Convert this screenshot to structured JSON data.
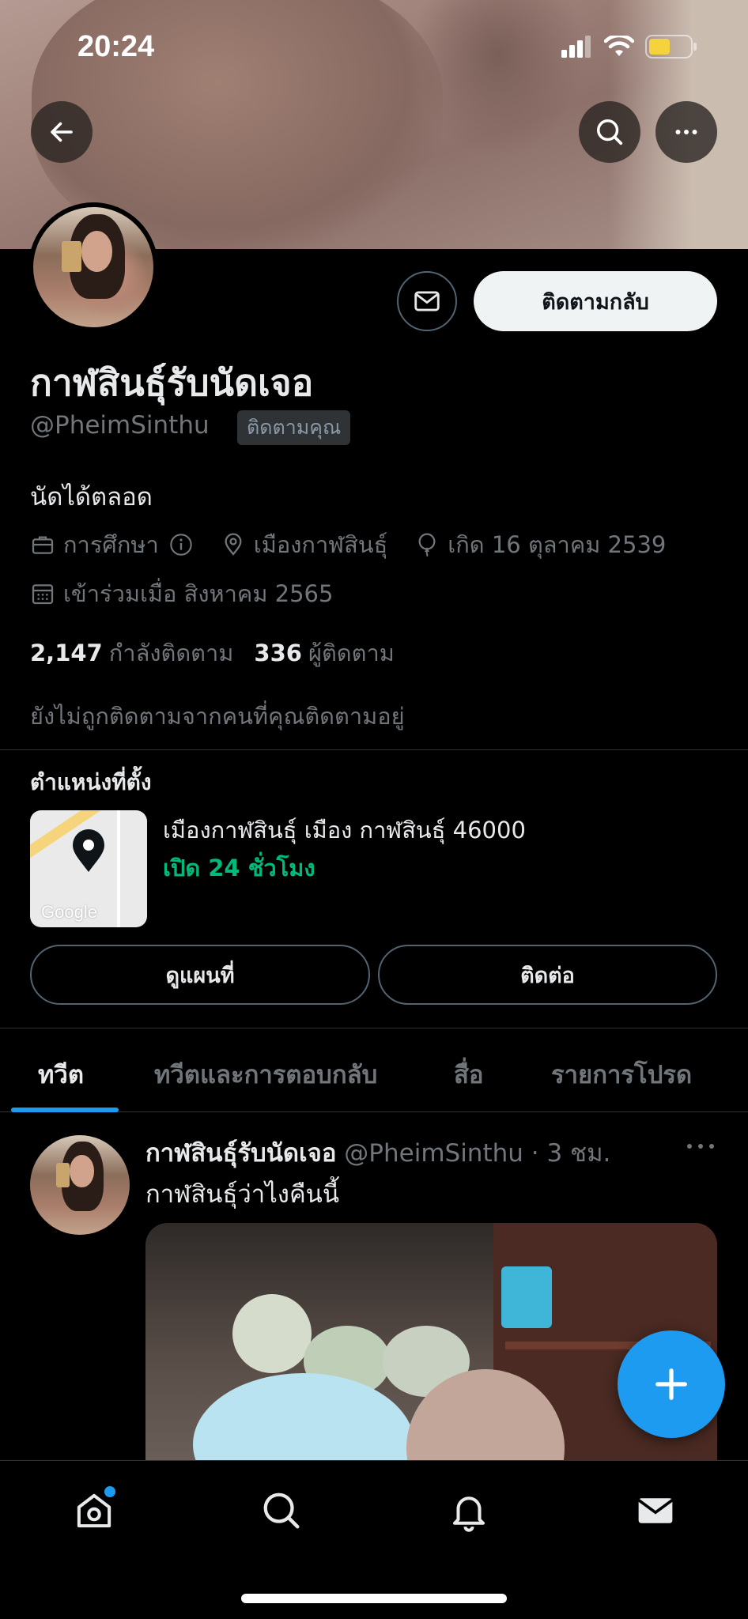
{
  "status_bar": {
    "time": "20:24"
  },
  "header": {
    "back_icon": "arrow-left-icon",
    "search_icon": "search-icon",
    "more_icon": "more-horizontal-icon"
  },
  "profile": {
    "display_name": "กาฬสินธุ์รับนัดเจอ",
    "handle": "@PheimSinthu",
    "follows_you_badge": "ติดตามคุณ",
    "follow_back_label": "ติดตามกลับ",
    "bio": "นัดได้ตลอด",
    "category": "การศึกษา",
    "location": "เมืองกาฬสินธุ์",
    "birthday": "เกิด 16 ตุลาคม 2539",
    "joined": "เข้าร่วมเมื่อ สิงหาคม 2565",
    "following_count": "2,147",
    "following_label": "กำลังติดตาม",
    "followers_count": "336",
    "followers_label": "ผู้ติดตาม",
    "not_followed_text": "ยังไม่ถูกติดตามจากคนที่คุณติดตามอยู่"
  },
  "location_card": {
    "title": "ตำแหน่งที่ตั้ง",
    "map_brand": "Google",
    "address": "เมืองกาฬสินธุ์ เมือง กาฬสินธุ์ 46000",
    "hours": "เปิด 24 ชั่วโมง",
    "view_map_label": "ดูแผนที่",
    "contact_label": "ติดต่อ",
    "open_color": "#00ba7c"
  },
  "tabs": [
    {
      "label": "ทวีต"
    },
    {
      "label": "ทวีตและการตอบกลับ"
    },
    {
      "label": "สื่อ"
    },
    {
      "label": "รายการโปรด"
    }
  ],
  "tweet": {
    "author_name": "กาฬสินธุ์รับนัดเจอ",
    "author_meta": " @PheimSinthu · 3 ชม.",
    "text": "กาฬสินธุ์ว่าไงคืนนี้"
  },
  "colors": {
    "accent": "#1d9bf0",
    "background": "#000000"
  }
}
